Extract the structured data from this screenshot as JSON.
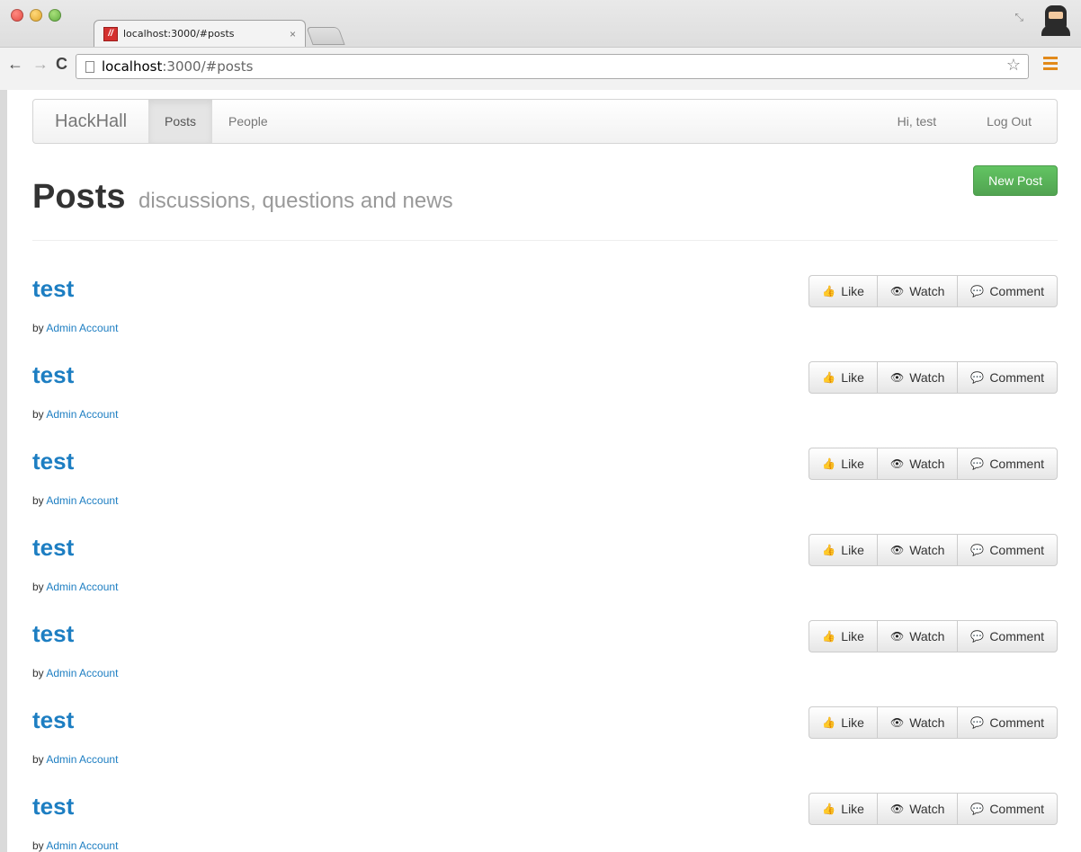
{
  "browser": {
    "tab": {
      "favicon_text": "//",
      "title": "localhost:3000/#posts",
      "close": "×"
    },
    "url_host": "localhost",
    "url_rest": ":3000/#posts"
  },
  "navbar": {
    "brand": "HackHall",
    "links": [
      "Posts",
      "People"
    ],
    "greeting": "Hi, test",
    "logout": "Log Out"
  },
  "header": {
    "title": "Posts",
    "subtitle": "discussions, questions and news",
    "new_post": "New Post"
  },
  "post_action_labels": {
    "like": "Like",
    "watch": "Watch",
    "comment": "Comment"
  },
  "posts": [
    {
      "title": "test",
      "by": "by",
      "author": "Admin Account"
    },
    {
      "title": "test",
      "by": "by",
      "author": "Admin Account"
    },
    {
      "title": "test",
      "by": "by",
      "author": "Admin Account"
    },
    {
      "title": "test",
      "by": "by",
      "author": "Admin Account"
    },
    {
      "title": "test",
      "by": "by",
      "author": "Admin Account"
    },
    {
      "title": "test",
      "by": "by",
      "author": "Admin Account"
    },
    {
      "title": "test",
      "by": "by",
      "author": "Admin Account"
    }
  ],
  "colors": {
    "link": "#1d7ec2",
    "success": "#51a351"
  }
}
